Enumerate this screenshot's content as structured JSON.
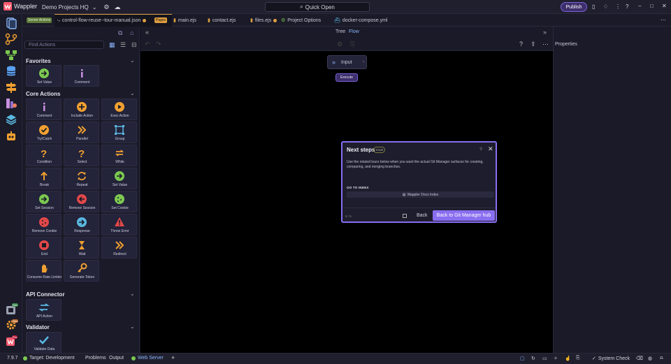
{
  "topbar": {
    "app_name": "Wappler",
    "project": "Demo Projects HQ",
    "quick_open": "Quick Open",
    "publish": "Publish"
  },
  "activity_badges": {
    "dev": "Dev",
    "badge2": "Dev",
    "pro": "Pro"
  },
  "tabs": [
    {
      "badge": "Server Actions",
      "label": "control-flow-reuse--tour-manual.json"
    },
    {
      "badge": "Pages",
      "label": "main.ejs"
    },
    {
      "label": "contact.ejs"
    },
    {
      "label": "files.ejs"
    },
    {
      "label": "Project Options"
    },
    {
      "label": "docker-compose.yml"
    }
  ],
  "left_panel": {
    "search_placeholder": "Find Actions",
    "sections": {
      "favorites": "Favorites",
      "core": "Core Actions",
      "api": "API Connector",
      "validator": "Validator"
    },
    "favorites": [
      "Set Value",
      "Comment"
    ],
    "core": [
      "Comment",
      "Include Action",
      "Exec Action",
      "Try/Catch",
      "Parallel",
      "Group",
      "Condition",
      "Select",
      "While",
      "Break",
      "Repeat",
      "Set Value",
      "Set Session",
      "Remove Session",
      "Set Cookie",
      "Remove Cookie",
      "Response",
      "Throw Error",
      "End",
      "Wait",
      "Redirect",
      "Consume Rate Limiter",
      "Generate Token"
    ],
    "api": [
      "API Action"
    ],
    "validator": [
      "Validate Data"
    ]
  },
  "canvas": {
    "tree_tab": "Tree",
    "flow_tab": "Flow",
    "input_node": "Input",
    "execute_node": "Execute"
  },
  "right_panel": {
    "title": "Properties"
  },
  "dialog": {
    "title": "Next steps",
    "badge": "TOUR",
    "body": "Use the related tours below when you want the actual Git Manager surfaces for creating, comparing, and merging branches.",
    "goto_label": "GO TO INDEX",
    "docs_link": "Wappler Docs Index",
    "step": "5 / 5",
    "back": "Back",
    "next": "Back to Git Manager hub"
  },
  "statusbar": {
    "version": "7.9.7",
    "target": "Target: Development",
    "problems": "Problems",
    "output": "Output",
    "web_server": "Web Server",
    "system_check": "System Check"
  },
  "colors": {
    "accent": "#8a6ef0",
    "canvas": "#000000",
    "orange": "#f0a030",
    "green": "#7cc850",
    "red": "#e04848"
  }
}
